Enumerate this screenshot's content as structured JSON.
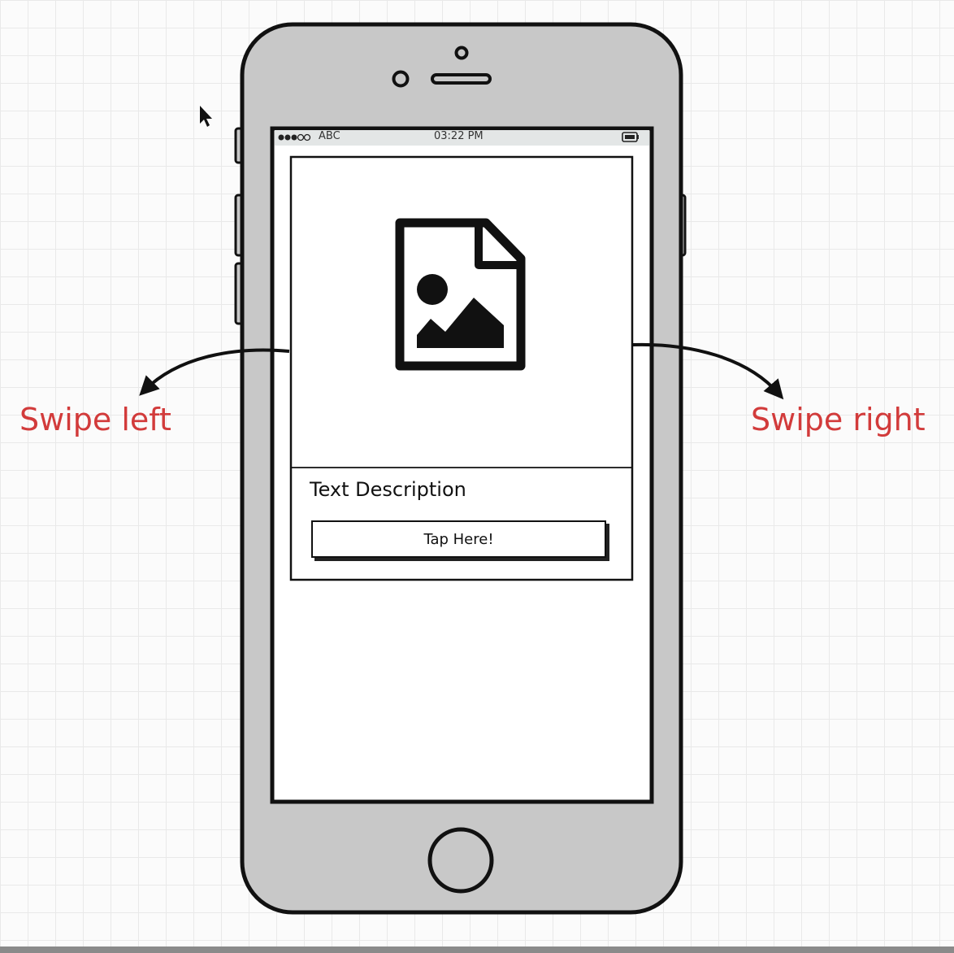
{
  "colors": {
    "accent": "#d23b3b",
    "phone_body": "#c8c8c8",
    "outline": "#111111",
    "status_bar": "#e3e6e6",
    "screen": "#ffffff"
  },
  "status_bar": {
    "carrier": "ABC",
    "time": "03:22 PM",
    "signal_icon": "signal-dots-icon",
    "battery_icon": "battery-icon"
  },
  "card": {
    "image_icon": "image-file-icon",
    "description": "Text Description",
    "button_label": "Tap Here!"
  },
  "annotations": {
    "left_label": "Swipe left",
    "right_label": "Swipe right"
  }
}
